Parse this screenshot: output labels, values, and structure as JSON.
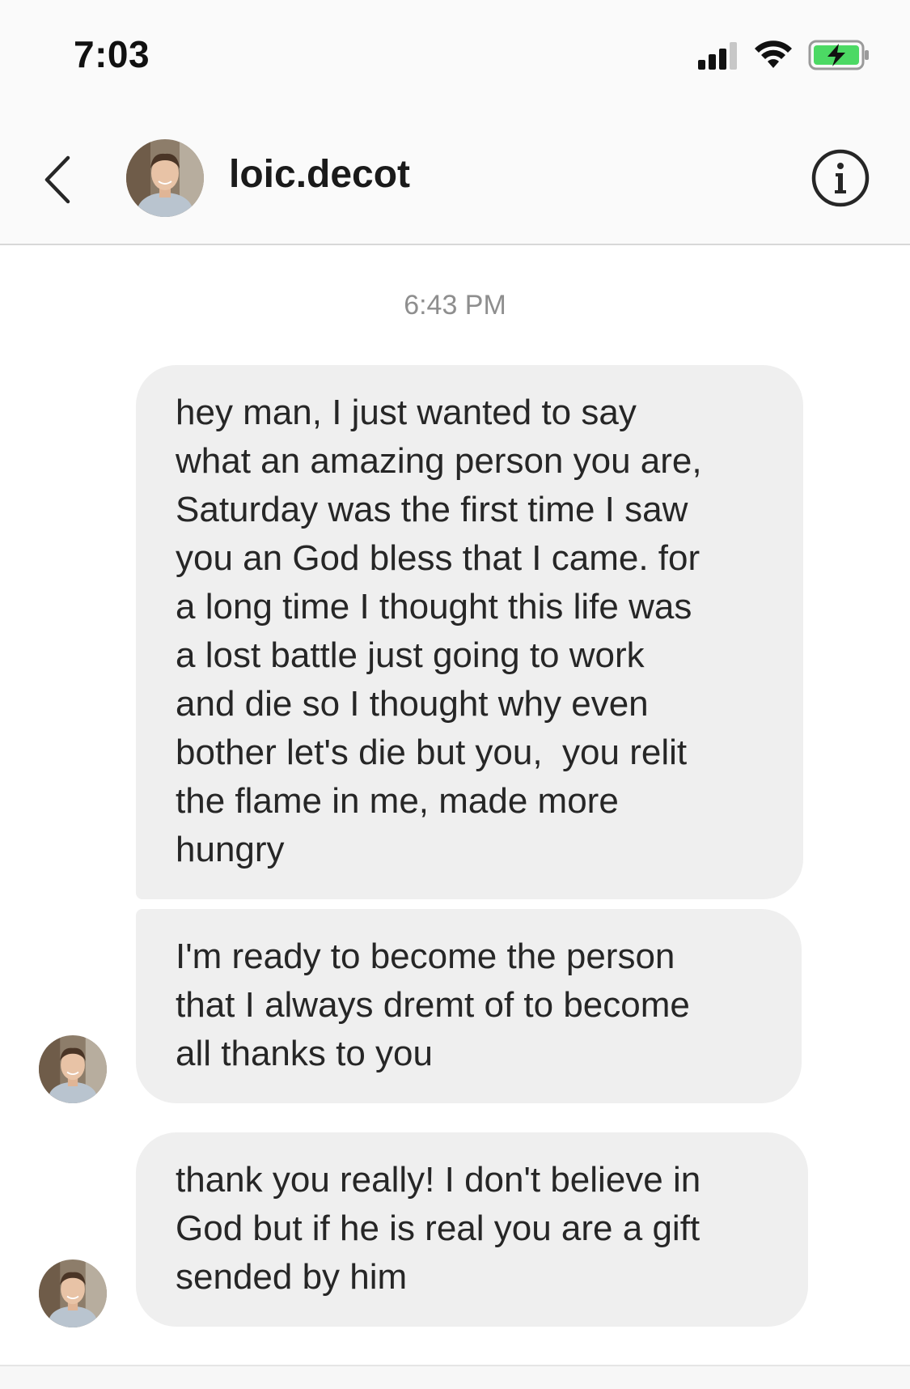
{
  "status_bar": {
    "time": "7:03",
    "icons": [
      "cellular-signal-icon",
      "wifi-icon",
      "battery-charging-icon"
    ],
    "battery_color": "#4cd964"
  },
  "header": {
    "username": "loic.decot",
    "back_icon": "chevron-left-icon",
    "info_icon": "info-circle-icon"
  },
  "thread": {
    "timestamp": "6:43 PM",
    "messages": [
      {
        "lines": [
          "hey man, I just wanted to say",
          "what an amazing person you are,",
          "Saturday was the first time I saw",
          "you an God bless that I came. for",
          "a long time I thought this life was",
          "a lost battle just going to work",
          "and die so I thought why even",
          "bother let's die but you,  you relit",
          "the flame in me, made more",
          "hungry"
        ]
      },
      {
        "lines": [
          "I'm ready to become the person",
          "that I always dremt of to become",
          "all thanks to you"
        ]
      },
      {
        "lines": [
          "thank you really! I don't believe in",
          "God but if he is real you are a gift",
          "sended by him"
        ]
      }
    ]
  },
  "colors": {
    "bubble_bg": "#efefef",
    "timestamp_gray": "#8e8e8e",
    "header_bg": "#fafafa"
  }
}
